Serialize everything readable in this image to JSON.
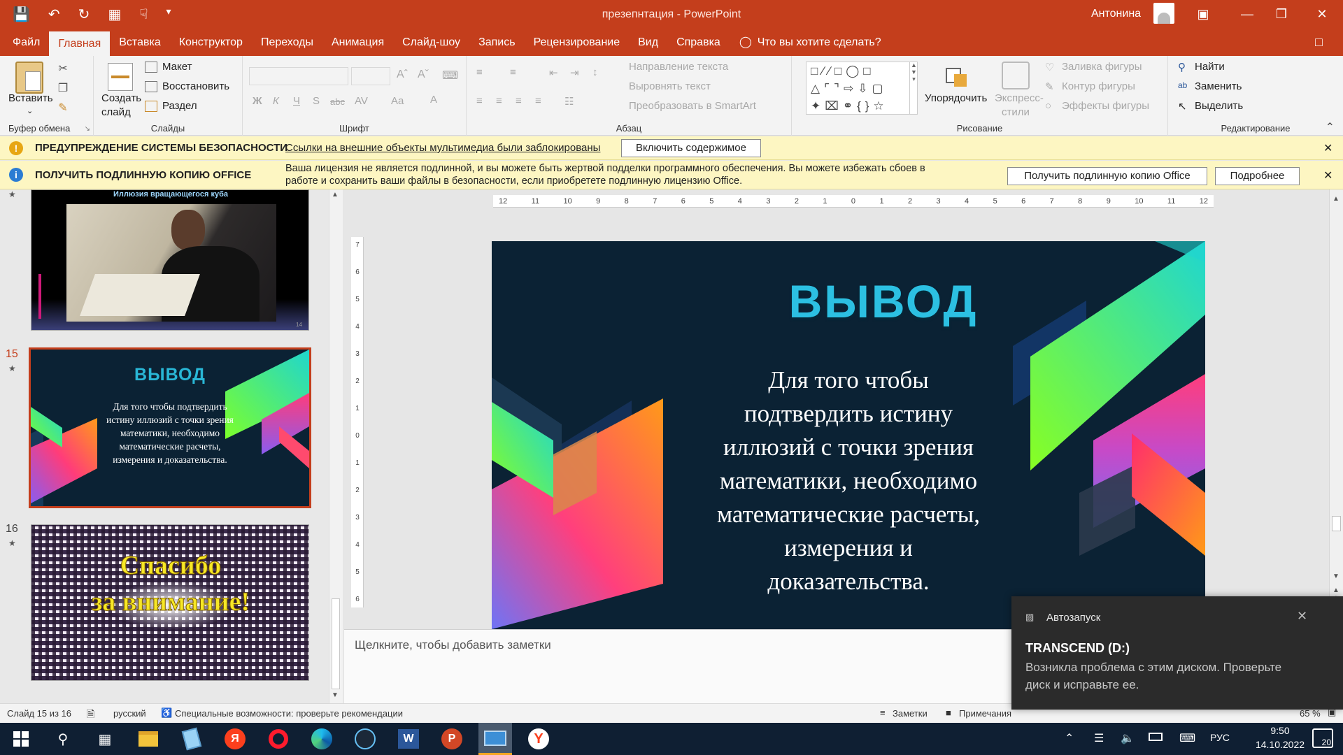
{
  "window": {
    "title": "презепнтация  -  PowerPoint",
    "user": "Антонина"
  },
  "tabs": [
    "Файл",
    "Главная",
    "Вставка",
    "Конструктор",
    "Переходы",
    "Анимация",
    "Слайд-шоу",
    "Запись",
    "Рецензирование",
    "Вид",
    "Справка"
  ],
  "tell_me": "Что вы хотите сделать?",
  "ribbon": {
    "clipboard": {
      "label": "Буфер обмена",
      "paste": "Вставить"
    },
    "slides": {
      "label": "Слайды",
      "new_slide_1": "Создать",
      "new_slide_2": "слайд",
      "layout": "Макет",
      "reset": "Восстановить",
      "section": "Раздел"
    },
    "font": {
      "label": "Шрифт"
    },
    "paragraph": {
      "label": "Абзац",
      "text_direction": "Направление текста",
      "align_text": "Выровнять текст",
      "smartart": "Преобразовать в SmartArt"
    },
    "drawing": {
      "label": "Рисование",
      "arrange": "Упорядочить",
      "quick_styles_1": "Экспресс-",
      "quick_styles_2": "стили",
      "fill": "Заливка фигуры",
      "outline": "Контур фигуры",
      "effects": "Эффекты фигуры"
    },
    "editing": {
      "label": "Редактирование",
      "find": "Найти",
      "replace": "Заменить",
      "select": "Выделить"
    }
  },
  "security_bar": {
    "title": "ПРЕДУПРЕЖДЕНИЕ СИСТЕМЫ БЕЗОПАСНОСТИ",
    "message": "Ссылки на внешние объекты мультимедиа были заблокированы",
    "button": "Включить содержимое"
  },
  "license_bar": {
    "title": "ПОЛУЧИТЬ ПОДЛИННУЮ КОПИЮ OFFICE",
    "message_1": "Ваша лицензия не является подлинной, и вы можете быть жертвой подделки программного обеспечения. Вы можете избежать сбоев в",
    "message_2": "работе и сохранить ваши файлы в безопасности, если приобретете подлинную лицензию Office.",
    "button_get": "Получить подлинную копию Office",
    "button_more": "Подробнее"
  },
  "thumbnails": [
    {
      "number": "",
      "caption": "Иллюзия вращающегося куба",
      "page": "14"
    },
    {
      "number": "15",
      "title": "ВЫВОД",
      "body": "Для того чтобы подтвердить истину иллюзий с точки зрения математики, необходимо математические расчеты, измерения и доказательства."
    },
    {
      "number": "16",
      "text_1": "Спасибо",
      "text_2": "за внимание!"
    }
  ],
  "ruler_h": [
    "12",
    "11",
    "10",
    "9",
    "8",
    "7",
    "6",
    "5",
    "4",
    "3",
    "2",
    "1",
    "0",
    "1",
    "2",
    "3",
    "4",
    "5",
    "6",
    "7",
    "8",
    "9",
    "10",
    "11",
    "12"
  ],
  "ruler_v": [
    "7",
    "6",
    "5",
    "4",
    "3",
    "2",
    "1",
    "0",
    "1",
    "2",
    "3",
    "4",
    "5",
    "6"
  ],
  "slide": {
    "title": "ВЫВОД",
    "body_lines": [
      "Для того чтобы",
      "подтвердить истину",
      "иллюзий с точки зрения",
      "математики, необходимо",
      "математические расчеты,",
      "измерения и",
      "доказательства."
    ]
  },
  "notes_placeholder": "Щелкните, чтобы добавить заметки",
  "status": {
    "slide": "Слайд 15 из 16",
    "language": "русский",
    "accessibility": "Специальные возможности: проверьте рекомендации",
    "notes": "Заметки",
    "comments": "Примечания",
    "zoom": "65 %"
  },
  "toast": {
    "app": "Автозапуск",
    "title": "TRANSCEND (D:)",
    "message_1": "Возникла проблема с этим диском. Проверьте",
    "message_2": "диск и исправьте ее."
  },
  "tray": {
    "lang": "РУС",
    "time": "9:50",
    "date": "14.10.2022",
    "notif_count": "20"
  },
  "colors": {
    "accent": "#c43e1c",
    "slide_bg": "#0b2234",
    "title_cyan": "#29b7d6",
    "warning_bar": "#fdf6c2",
    "taskbar": "#0f1f33"
  }
}
